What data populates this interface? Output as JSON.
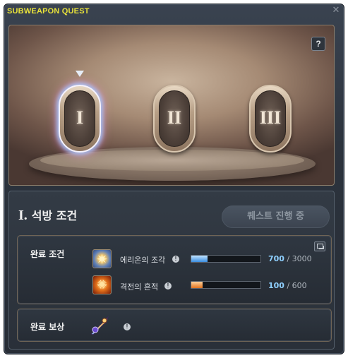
{
  "window": {
    "title": "SUBWEAPON QUEST",
    "close_icon": "close-icon",
    "help_label": "?"
  },
  "stages": [
    {
      "numeral": "I",
      "selected": true
    },
    {
      "numeral": "II",
      "selected": false
    },
    {
      "numeral": "III",
      "selected": false
    }
  ],
  "panel": {
    "phase_numeral": "I.",
    "phase_title": "석방 조건",
    "status_button": "퀘스트 진행 중"
  },
  "completion": {
    "label": "완료 조건",
    "items": [
      {
        "name": "에리온의 조각",
        "current": "700",
        "total": "/ 3000",
        "progress": 0.233,
        "color": "#3c8ee0",
        "icon": "fragment-icon"
      },
      {
        "name": "격전의 흔적",
        "current": "100",
        "total": "/ 600",
        "progress": 0.167,
        "color": "#e0731f",
        "icon": "battle-trace-icon"
      }
    ]
  },
  "reward": {
    "label": "완료 보상",
    "icon": "subweapon-icon"
  },
  "info_glyph": "!"
}
